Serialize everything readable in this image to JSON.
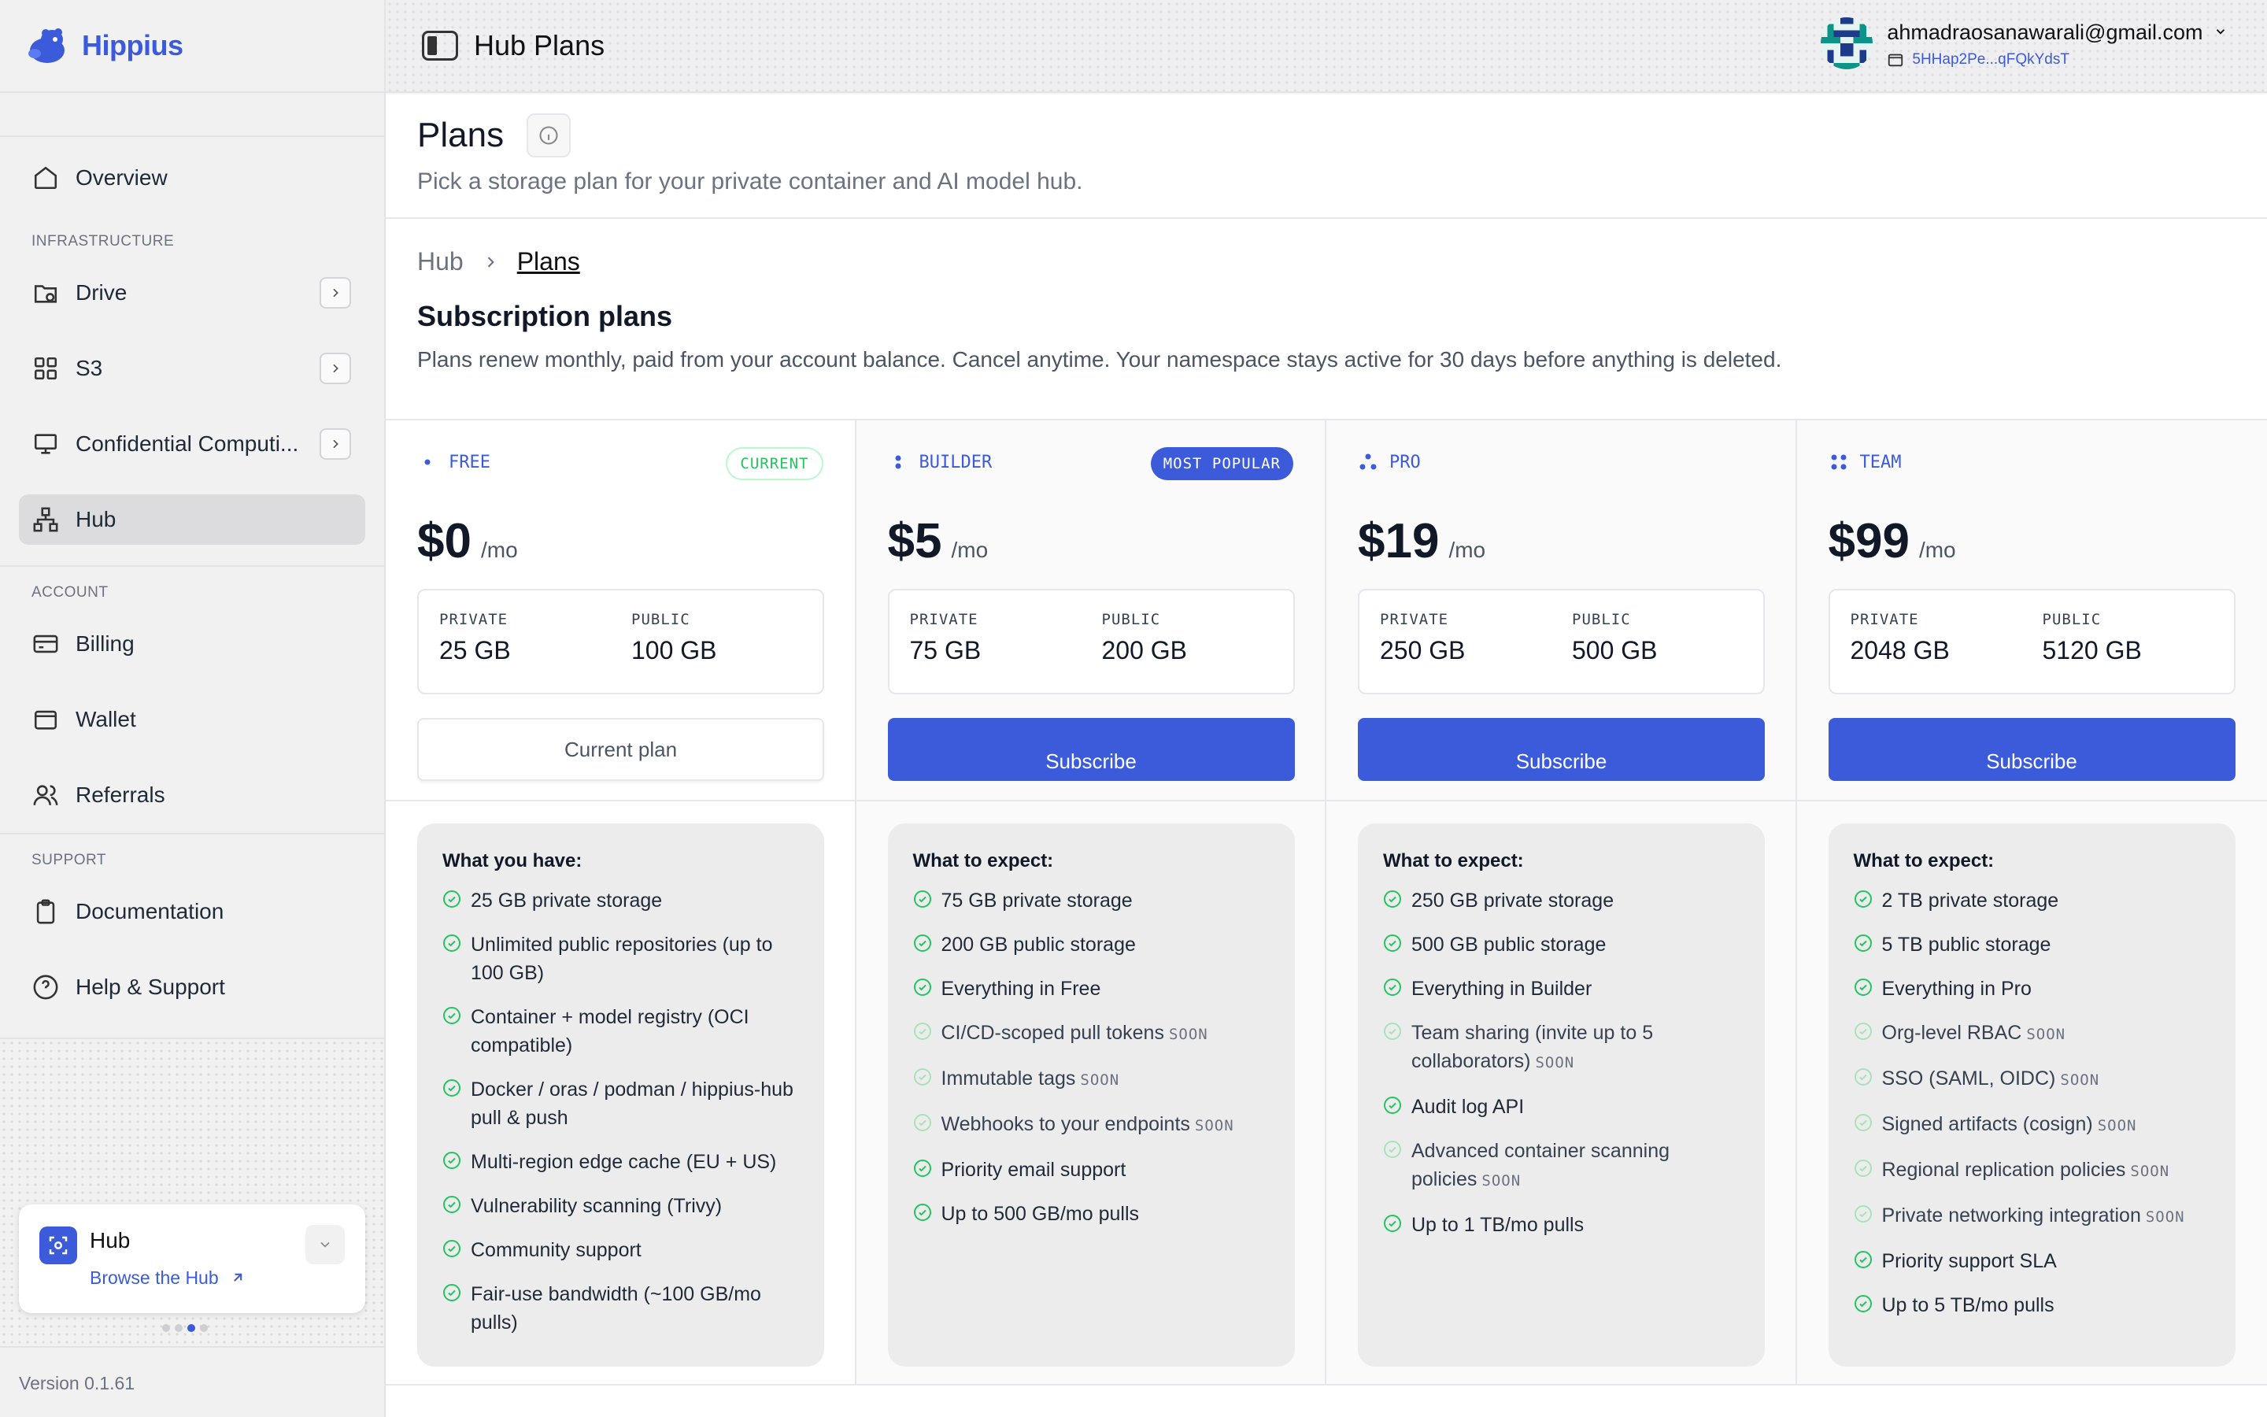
{
  "brand": "Hippius",
  "sidebar": {
    "overview": "Overview",
    "infra_label": "INFRASTRUCTURE",
    "drive": "Drive",
    "s3": "S3",
    "confidential": "Confidential Computi...",
    "hub": "Hub",
    "account_label": "ACCOUNT",
    "billing": "Billing",
    "wallet": "Wallet",
    "referrals": "Referrals",
    "support_label": "SUPPORT",
    "documentation": "Documentation",
    "help": "Help & Support",
    "card_title": "Hub",
    "card_link": "Browse the Hub",
    "version": "Version 0.1.61"
  },
  "topbar": {
    "title": "Hub Plans",
    "email": "ahmadraosanawarali@gmail.com",
    "wallet": "5HHap2Pe...qFQkYdsT"
  },
  "page": {
    "title": "Plans",
    "subtitle": "Pick a storage plan for your private container and AI model hub.",
    "crumb_root": "Hub",
    "crumb_current": "Plans",
    "section_title": "Subscription plans",
    "section_desc": "Plans renew monthly, paid from your account balance. Cancel anytime. Your namespace stays active for 30 days before anything is deleted."
  },
  "labels": {
    "private": "PRIVATE",
    "public": "PUBLIC",
    "per": "/mo",
    "soon": "SOON"
  },
  "plans": [
    {
      "name": "FREE",
      "badge": "CURRENT",
      "price": "$0",
      "private": "25 GB",
      "public": "100 GB",
      "button": "Current plan",
      "features_title": "What you have:",
      "features": [
        "25 GB private storage",
        "Unlimited public repositories (up to 100 GB)",
        "Container + model registry (OCI compatible)",
        "Docker / oras / podman / hippius-hub pull & push",
        "Multi-region edge cache (EU + US)",
        "Vulnerability scanning (Trivy)",
        "Community support",
        "Fair-use bandwidth (~100 GB/mo pulls)"
      ]
    },
    {
      "name": "BUILDER",
      "badge": "MOST POPULAR",
      "price": "$5",
      "private": "75 GB",
      "public": "200 GB",
      "button": "Subscribe",
      "features_title": "What to expect:",
      "features": [
        "75 GB private storage",
        "200 GB public storage",
        "Everything in Free",
        "CI/CD-scoped pull tokens",
        "Immutable tags",
        "Webhooks to your endpoints",
        "Priority email support",
        "Up to 500 GB/mo pulls"
      ]
    },
    {
      "name": "PRO",
      "badge": "",
      "price": "$19",
      "private": "250 GB",
      "public": "500 GB",
      "button": "Subscribe",
      "features_title": "What to expect:",
      "features": [
        "250 GB private storage",
        "500 GB public storage",
        "Everything in Builder",
        "Team sharing (invite up to 5 collaborators)",
        "Audit log API",
        "Advanced container scanning policies",
        "Up to 1 TB/mo pulls"
      ]
    },
    {
      "name": "TEAM",
      "badge": "",
      "price": "$99",
      "private": "2048 GB",
      "public": "5120 GB",
      "button": "Subscribe",
      "features_title": "What to expect:",
      "features": [
        "2 TB private storage",
        "5 TB public storage",
        "Everything in Pro",
        "Org-level RBAC",
        "SSO (SAML, OIDC)",
        "Signed artifacts (cosign)",
        "Regional replication policies",
        "Private networking integration",
        "Priority support SLA",
        "Up to 5 TB/mo pulls"
      ]
    }
  ],
  "colors": {
    "accent": "#3b5bdb",
    "check": "#22c55e",
    "soon_check": "#a7e3b9"
  }
}
